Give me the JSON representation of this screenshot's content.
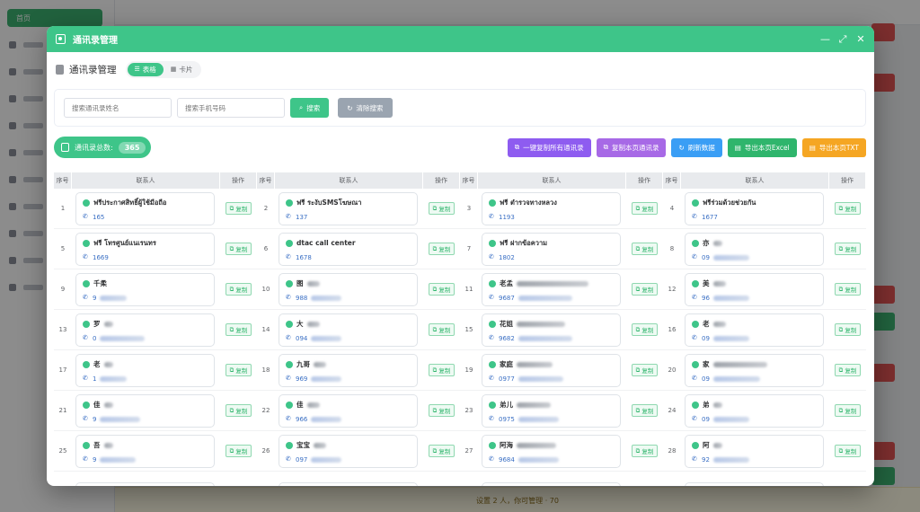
{
  "background": {
    "sidebar_top": "首页",
    "footer_text": "设置 2 人，你可管理 · 70"
  },
  "modal": {
    "title": "通讯录管理",
    "section_title": "通讯录管理",
    "view_toggle": [
      {
        "label": "表格",
        "active": true
      },
      {
        "label": "卡片",
        "active": false
      }
    ],
    "search": {
      "name_placeholder": "搜索通讯录姓名",
      "phone_placeholder": "搜索手机号码",
      "search_label": "搜索",
      "clear_label": "清除搜索"
    },
    "total_label": "通讯录总数:",
    "total_count": "365",
    "actions": {
      "copy_all": "一键复制所有通讯录",
      "copy_page": "复制本页通讯录",
      "refresh": "刷新数据",
      "export_excel": "导出本页Excel",
      "export_txt": "导出本页TXT"
    },
    "columns": {
      "seq": "序号",
      "contact": "联系人",
      "op": "操作"
    },
    "copy_label": "复制",
    "rows": [
      [
        {
          "seq": "1",
          "name": "ฟรีประกาศสิทธิ์ผู้ใช้มือถือ",
          "phone": "165"
        },
        {
          "seq": "2",
          "name": "ฟรี   ระงับSMSโฆษณา",
          "phone": "137"
        },
        {
          "seq": "3",
          "name": "ฟรี   ตำรวจทางหลวง",
          "phone": "1193"
        },
        {
          "seq": "4",
          "name": "ฟรีร่วมด้วยช่วยกัน",
          "phone": "1677"
        }
      ],
      [
        {
          "seq": "5",
          "name": "ฟรี   โทรศูนย์แนเรนทร",
          "phone": "1669"
        },
        {
          "seq": "6",
          "name": "dtac    call    center",
          "phone": "1678"
        },
        {
          "seq": "7",
          "name": "ฟรี   ฝากข้อความ",
          "phone": "1802"
        },
        {
          "seq": "8",
          "name": "亦",
          "phone": "09"
        }
      ],
      [
        {
          "seq": "9",
          "name": "千柔",
          "phone": "9"
        },
        {
          "seq": "10",
          "name": "图",
          "phone": "988"
        },
        {
          "seq": "11",
          "name": "老孟",
          "phone": "9687"
        },
        {
          "seq": "12",
          "name": "美",
          "phone": "96"
        }
      ],
      [
        {
          "seq": "13",
          "name": "罗",
          "phone": "0"
        },
        {
          "seq": "14",
          "name": "大",
          "phone": "094"
        },
        {
          "seq": "15",
          "name": "花姐",
          "phone": "9682"
        },
        {
          "seq": "16",
          "name": "老",
          "phone": "09"
        }
      ],
      [
        {
          "seq": "17",
          "name": "老",
          "phone": "1"
        },
        {
          "seq": "18",
          "name": "九哥",
          "phone": "969"
        },
        {
          "seq": "19",
          "name": "家庭",
          "phone": "0977"
        },
        {
          "seq": "20",
          "name": "家",
          "phone": "09"
        }
      ],
      [
        {
          "seq": "21",
          "name": "佳",
          "phone": "9"
        },
        {
          "seq": "22",
          "name": "佳",
          "phone": "966"
        },
        {
          "seq": "23",
          "name": "弟儿",
          "phone": "0975"
        },
        {
          "seq": "24",
          "name": "弟",
          "phone": "09"
        }
      ],
      [
        {
          "seq": "25",
          "name": "吾",
          "phone": "9"
        },
        {
          "seq": "26",
          "name": "宝宝",
          "phone": "097"
        },
        {
          "seq": "27",
          "name": "阿海",
          "phone": "9684"
        },
        {
          "seq": "28",
          "name": "阿",
          "phone": "92"
        }
      ],
      [
        {
          "seq": "",
          "name": "",
          "phone": ""
        },
        {
          "seq": "",
          "name": "",
          "phone": ""
        },
        {
          "seq": "",
          "name": "",
          "phone": ""
        },
        {
          "seq": "",
          "name": "",
          "phone": ""
        }
      ]
    ]
  },
  "colors": {
    "accent": "#3ec589",
    "purple": "#8e5cf0",
    "blue": "#3a9ef5",
    "orange": "#f5a623"
  }
}
